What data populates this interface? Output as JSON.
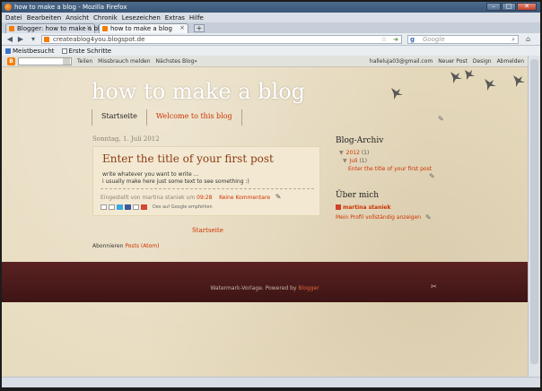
{
  "window": {
    "title": "how to make a blog - Mozilla Firefox",
    "buttons": [
      "–",
      "□",
      "✕"
    ]
  },
  "menu": [
    "Datei",
    "Bearbeiten",
    "Ansicht",
    "Chronik",
    "Lesezeichen",
    "Extras",
    "Hilfe"
  ],
  "tabs": [
    {
      "label": "Blogger: how to make a blog...",
      "close": "×"
    },
    {
      "label": "how to make a blog",
      "close": "×"
    }
  ],
  "newtab_label": "+",
  "nav": {
    "url": "createablog4you.blogspot.de",
    "search_placeholder": "Google",
    "search_engine_letter": "g"
  },
  "bookmarks": [
    "Meistbesucht",
    "Erste Schritte"
  ],
  "blogger_nav": {
    "links": [
      "Teilen",
      "Missbrauch melden",
      "Nächstes Blog»"
    ],
    "right": [
      "halleluja03@gmail.com",
      "Neuer Post",
      "Design",
      "Abmelden"
    ]
  },
  "blog": {
    "title": "how to make a blog",
    "pages": [
      "Startseite",
      "Welcome to this blog"
    ]
  },
  "post": {
    "date": "Sonntag, 1. Juli 2012",
    "title": "Enter the title of your first post",
    "body_lines": [
      "write whatever you want to write ...",
      "i usually make here just some text to see something :)"
    ],
    "meta_prefix": "Eingestellt von martina staniek um",
    "time": "09:28",
    "comments": "Keine Kommentare",
    "share_label": "Des auf Google empfehlen"
  },
  "home_link": "Startseite",
  "subscribe": {
    "prefix": "Abonnieren",
    "link": "Posts (Atom)"
  },
  "sidebar": {
    "archive_title": "Blog-Archiv",
    "archive": [
      {
        "label": "2012",
        "count": "(1)"
      },
      {
        "label": "Juli",
        "count": "(1)"
      },
      {
        "label": "Enter the title of your first post"
      }
    ],
    "about_title": "Über mich",
    "profile_name": "martina staniek",
    "profile_link": "Mein Profil vollständig anzeigen"
  },
  "footer": {
    "text": "Watermark-Vorlage. Powered by",
    "link": "Blogger"
  },
  "colors": {
    "link": "#cc3300",
    "footer_bg": "#4a1a1a",
    "page_bg": "#e8dcc0"
  }
}
